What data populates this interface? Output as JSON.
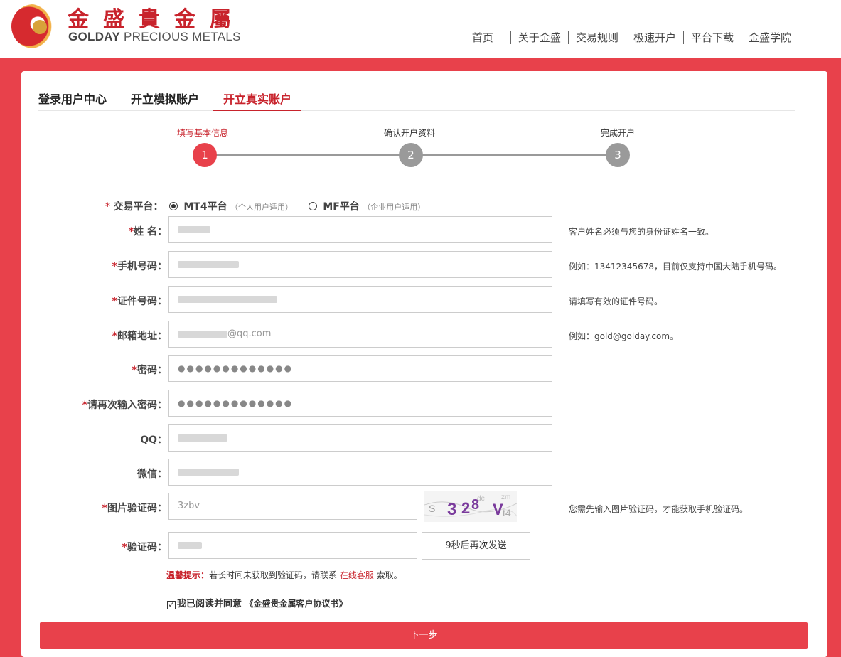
{
  "brand": {
    "name_cn": "金盛貴金屬",
    "name_en_bold": "GOLDAY",
    "name_en_rest": " PRECIOUS METALS",
    "accent": "#e8414b"
  },
  "top_nav": [
    "首页",
    "关于金盛",
    "交易规则",
    "极速开户",
    "平台下载",
    "金盛学院"
  ],
  "tabs": [
    "登录用户中心",
    "开立模拟账户",
    "开立真实账户"
  ],
  "steps": [
    {
      "label": "填写基本信息",
      "number": "1",
      "active": true
    },
    {
      "label": "确认开户资料",
      "number": "2",
      "active": false
    },
    {
      "label": "完成开户",
      "number": "3",
      "active": false
    }
  ],
  "platform": {
    "label_star": "*",
    "label": "交易平台：",
    "option1_name": "MT4平台",
    "option1_note": "（个人用户适用）",
    "option2_name": "MF平台",
    "option2_note": "（企业用户适用）",
    "selected": "MT4平台"
  },
  "fields": {
    "name": {
      "label": "姓 名：",
      "hint": "客户姓名必须与您的身份证姓名一致。"
    },
    "phone": {
      "label": "手机号码：",
      "hint": "例如：13412345678，目前仅支持中国大陆手机号码。"
    },
    "id": {
      "label": "证件号码：",
      "hint": "请填写有效的证件号码。"
    },
    "email": {
      "label": "邮箱地址：",
      "value_suffix": "@qq.com",
      "hint": "例如：gold@golday.com。"
    },
    "password": {
      "label": "密码：",
      "value": "●●●●●●●●●●●●●"
    },
    "password2": {
      "label": "请再次输入密码：",
      "value": "●●●●●●●●●●●●●"
    },
    "qq": {
      "label": "QQ："
    },
    "wechat": {
      "label": "微信："
    },
    "captcha": {
      "label": "图片验证码：",
      "value": "3zbv",
      "hint": "您需先输入图片验证码，才能获取手机验证码。"
    },
    "sms": {
      "label": "验证码：",
      "send_button": "9秒后再次发送"
    }
  },
  "tip": {
    "prefix": "温馨提示：",
    "text": "若长时间未获取到验证码，请联系 ",
    "link": "在线客服",
    "suffix": " 索取。"
  },
  "agree": {
    "text": "我已阅读并同意",
    "doc": "《金盛贵金属客户协议书》",
    "checked": true
  },
  "next_button": "下一步"
}
